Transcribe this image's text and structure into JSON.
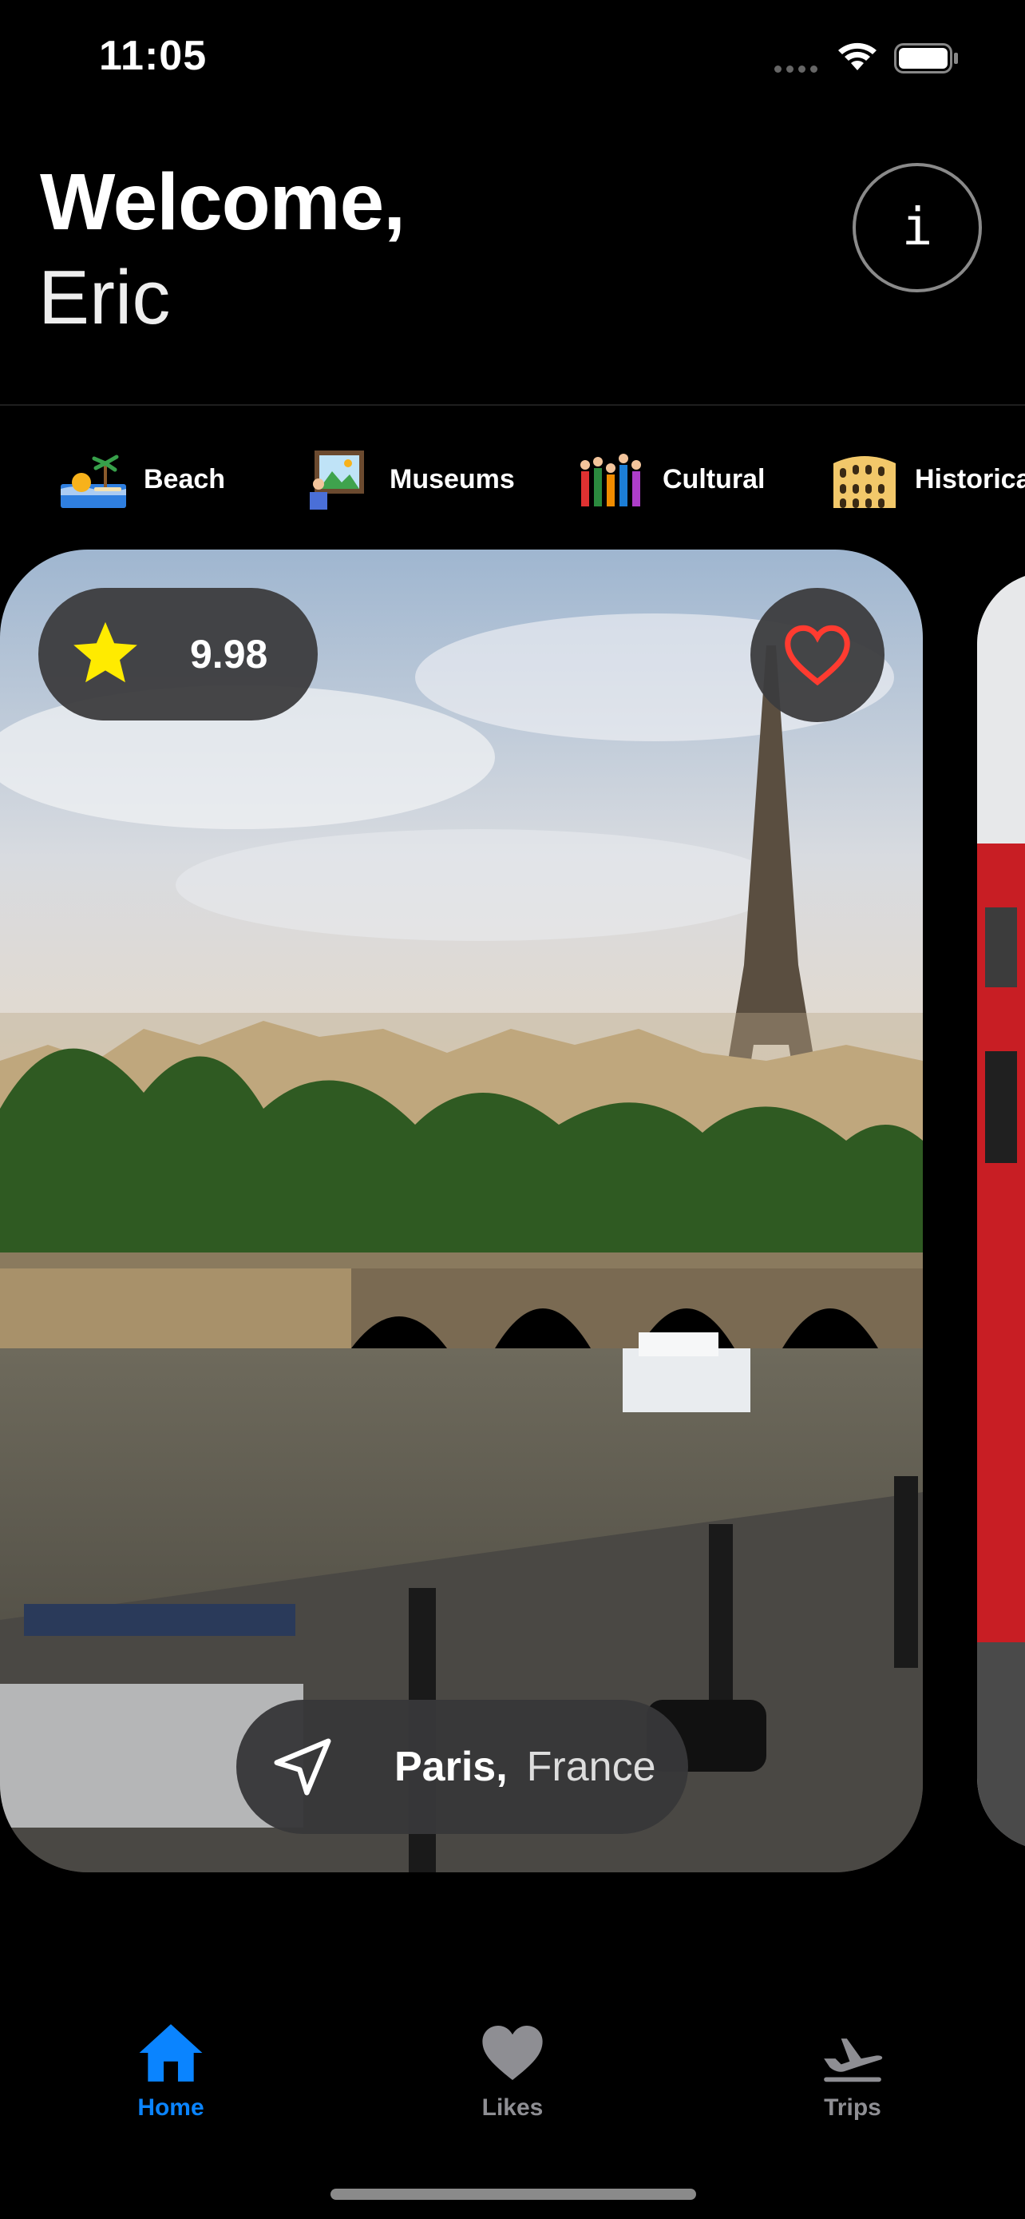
{
  "status_bar": {
    "time": "11:05",
    "icons": [
      "signal-icon",
      "wifi-icon",
      "battery-icon"
    ]
  },
  "header": {
    "greeting": "Welcome,",
    "username": "Eric",
    "info_icon_glyph": "i"
  },
  "categories": [
    {
      "label": "Beach",
      "icon": "beach-icon"
    },
    {
      "label": "Museums",
      "icon": "museum-icon"
    },
    {
      "label": "Cultural",
      "icon": "cultural-icon"
    },
    {
      "label": "Historica",
      "icon": "historical-icon"
    }
  ],
  "featured_card": {
    "rating": "9.98",
    "rating_icon": "star-icon",
    "rating_color": "#FFEB00",
    "liked_icon": "heart-outline-icon",
    "heart_color": "#FF3B30",
    "location_icon": "location-arrow-icon",
    "city": "Paris,",
    "country": "France",
    "image": "eiffel-tower-seine-photo"
  },
  "next_card": {
    "image": "london-red-bus-photo"
  },
  "tab_bar": {
    "active_color": "#0A84FF",
    "inactive_color": "#8E8E93",
    "tabs": [
      {
        "label": "Home",
        "icon": "house-icon",
        "active": true
      },
      {
        "label": "Likes",
        "icon": "heart-icon",
        "active": false
      },
      {
        "label": "Trips",
        "icon": "airplane-icon",
        "active": false
      }
    ]
  }
}
